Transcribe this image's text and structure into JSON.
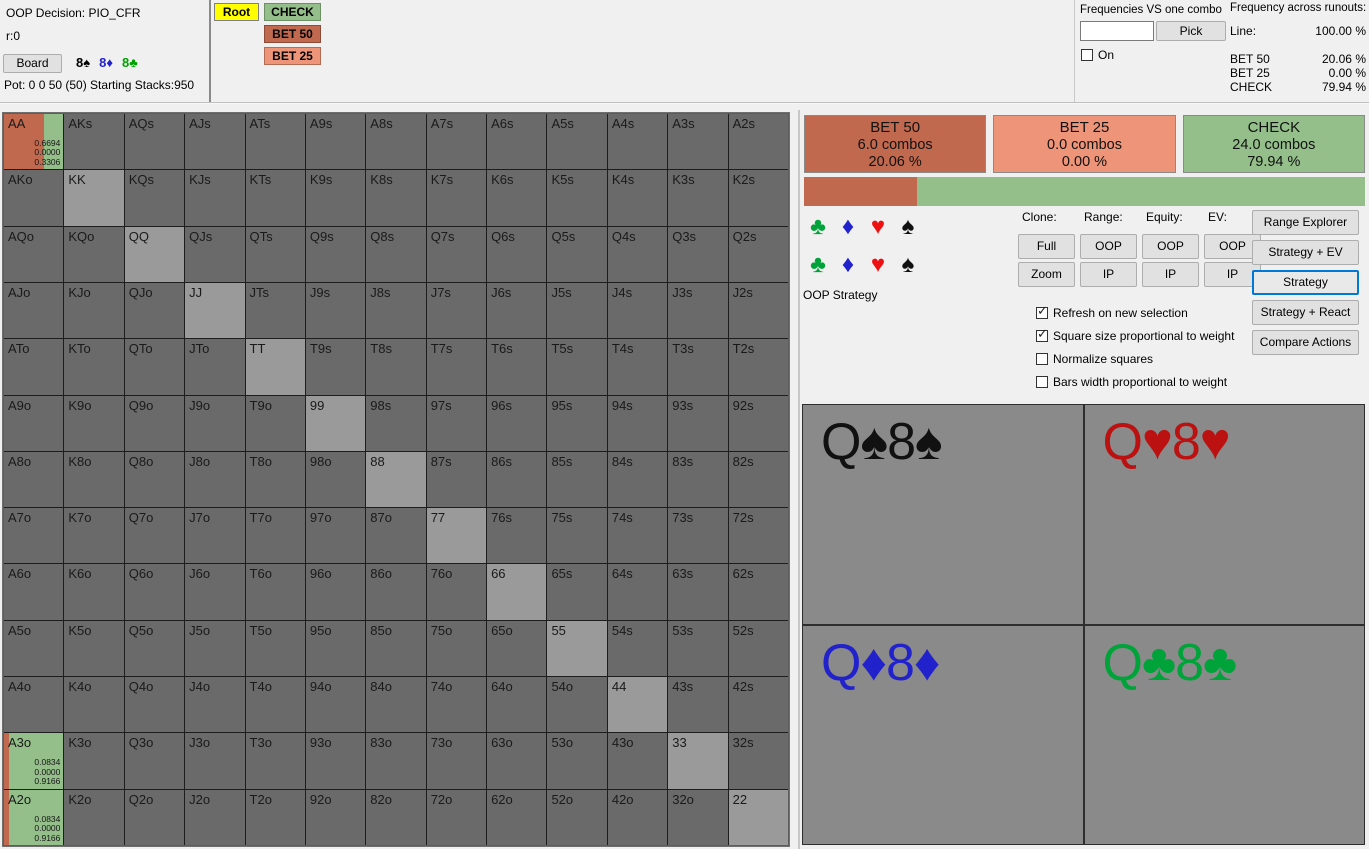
{
  "header": {
    "oop_decision_label": "OOP Decision:  PIO_CFR",
    "r_line": "r:0",
    "board_button": "Board",
    "board_cards": [
      {
        "rank": "8",
        "suit": "♠",
        "suit_name": "spade"
      },
      {
        "rank": "8",
        "suit": "♦",
        "suit_name": "diamond"
      },
      {
        "rank": "8",
        "suit": "♣",
        "suit_name": "club"
      }
    ],
    "pot_line": "Pot: 0 0 50 (50) Starting Stacks:950"
  },
  "tree": {
    "root": "Root",
    "nodes": [
      {
        "label": "CHECK",
        "color": "#94bf8a"
      },
      {
        "label": "BET 50",
        "color": "#c1694f"
      },
      {
        "label": "BET 25",
        "color": "#ee9478"
      }
    ]
  },
  "frequencies": {
    "vs_one_combo_title": "Frequencies VS one combo",
    "input_value": "",
    "pick_button": "Pick",
    "on_label": "On",
    "on_checked": false,
    "across_runouts_title": "Frequency across runouts:",
    "line_label": "Line:",
    "line_value": "100.00 %",
    "rows": [
      {
        "label": "BET 50",
        "value": "20.06 %"
      },
      {
        "label": "BET 25",
        "value": "0.00 %"
      },
      {
        "label": "CHECK",
        "value": "79.94 %"
      }
    ]
  },
  "actions": [
    {
      "name": "BET 50",
      "combos": "6.0 combos",
      "pct": "20.06 %",
      "color": "#c1694f",
      "fraction": 20.06
    },
    {
      "name": "BET 25",
      "combos": "0.0 combos",
      "pct": "0.00 %",
      "color": "#ee9478",
      "fraction": 0.0
    },
    {
      "name": "CHECK",
      "combos": "24.0 combos",
      "pct": "79.94 %",
      "color": "#94bf8a",
      "fraction": 79.94
    }
  ],
  "suit_rows": [
    [
      "♣",
      "♦",
      "♥",
      "♠"
    ],
    [
      "♣",
      "♦",
      "♥",
      "♠"
    ]
  ],
  "strategy_label": "OOP Strategy",
  "controls": {
    "column_labels": [
      "Clone:",
      "Range:",
      "Equity:",
      "EV:"
    ],
    "row1": [
      "Full",
      "OOP",
      "OOP",
      "OOP"
    ],
    "row2": [
      "Zoom",
      "IP",
      "IP",
      "IP"
    ]
  },
  "side_buttons": [
    {
      "label": "Range Explorer",
      "focused": false
    },
    {
      "label": "Strategy + EV",
      "focused": false
    },
    {
      "label": "Strategy",
      "focused": true
    },
    {
      "label": "Strategy + React",
      "focused": false
    },
    {
      "label": "Compare Actions",
      "focused": false
    }
  ],
  "checkboxes": [
    {
      "label": "Refresh on new selection",
      "checked": true
    },
    {
      "label": "Square size proportional to weight",
      "checked": true
    },
    {
      "label": "Normalize squares",
      "checked": false
    },
    {
      "label": "Bars width proportional to weight",
      "checked": false
    }
  ],
  "cards": [
    {
      "rank1": "Q",
      "suit1": "♠",
      "rank2": "8",
      "suit2": "♠",
      "class": "c-spade"
    },
    {
      "rank1": "Q",
      "suit1": "♥",
      "rank2": "8",
      "suit2": "♥",
      "class": "c-heart"
    },
    {
      "rank1": "Q",
      "suit1": "♦",
      "rank2": "8",
      "suit2": "♦",
      "class": "c-diamond"
    },
    {
      "rank1": "Q",
      "suit1": "♣",
      "rank2": "8",
      "suit2": "♣",
      "class": "c-club"
    }
  ],
  "colors": {
    "bet50": "#c1694f",
    "bet25": "#ee9478",
    "check": "#94bf8a",
    "cell_default": "#6a6a6a",
    "cell_pair": "#9a9a9a"
  },
  "matrix": {
    "ranks": [
      "A",
      "K",
      "Q",
      "J",
      "T",
      "9",
      "8",
      "7",
      "6",
      "5",
      "4",
      "3",
      "2"
    ],
    "highlighted": [
      {
        "hand": "AA",
        "row": 0,
        "col": 0,
        "bet50": "0.6694",
        "bet25": "0.0000",
        "check": "0.3306"
      },
      {
        "hand": "A3o",
        "row": 11,
        "col": 0,
        "bet50": "0.0834",
        "bet25": "0.0000",
        "check": "0.9166"
      },
      {
        "hand": "A2o",
        "row": 12,
        "col": 0,
        "bet50": "0.0834",
        "bet25": "0.0000",
        "check": "0.9166"
      }
    ]
  }
}
